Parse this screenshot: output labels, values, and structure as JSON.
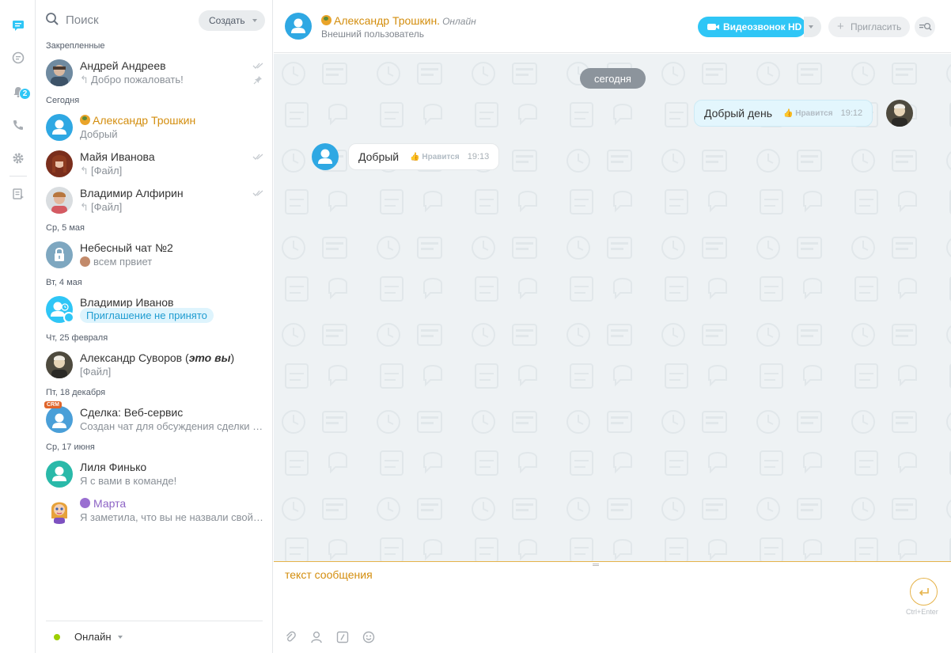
{
  "colors": {
    "accent": "#2fc6f6",
    "orange_name": "#d38d0d",
    "online": "#9dcf00",
    "send_border": "#e6b34a"
  },
  "rail": {
    "items": [
      {
        "icon": "chat-icon"
      },
      {
        "icon": "channels-icon"
      },
      {
        "icon": "bell-icon",
        "badge": "2"
      },
      {
        "icon": "phone-icon"
      },
      {
        "icon": "settings-icon"
      },
      {
        "icon": "tasks-icon"
      }
    ]
  },
  "recent": {
    "search_placeholder": "Поиск",
    "create_label": "Создать",
    "groups": {
      "pinned": "Закрепленные",
      "today": "Сегодня",
      "wed": "Ср, 5 мая",
      "tue": "Вт, 4 мая",
      "thu": "Чт, 25 февраля",
      "fri": "Пт, 18 декабря",
      "wed2": "Ср, 17 июня"
    },
    "items": [
      {
        "name": "Андрей Андреев",
        "sub": "Добро пожаловать!"
      },
      {
        "name": "Александр Трошкин",
        "sub": "Добрый"
      },
      {
        "name": "Майя Иванова",
        "sub": "[Файл]"
      },
      {
        "name": "Владимир Алфирин",
        "sub": "[Файл]"
      },
      {
        "name": "Небесный чат №2",
        "sub": "всем првиет"
      },
      {
        "name": "Владимир Иванов",
        "sub": "Приглашение не принято"
      },
      {
        "name": "Александр Суворов (",
        "name_em": "это вы",
        "name_end": ")",
        "sub": "[Файл]"
      },
      {
        "name": "Сделка: Веб-сервис",
        "sub": "Создан чат для обсуждения сделки «Веб-сервис»",
        "tag": "CRM"
      },
      {
        "name": "Лиля Финько",
        "sub": "Я с вами в команде!"
      },
      {
        "name": "Марта",
        "sub": "Я заметила, что вы не назвали свой отдел"
      }
    ],
    "status_label": "Онлайн"
  },
  "chat": {
    "header": {
      "name": "Александр Трошкин.",
      "online": "Онлайн",
      "description": "Внешний пользователь",
      "video_label": "Видеозвонок HD",
      "invite_label": "Пригласить"
    },
    "date_label": "сегодня",
    "messages": [
      {
        "text": "Добрый день",
        "like": "Нравится",
        "time": "19:12"
      },
      {
        "text": "Добрый",
        "like": "Нравится",
        "time": "19:13"
      }
    ],
    "composer": {
      "value": "текст сообщения",
      "send_hint": "Ctrl+Enter"
    }
  }
}
